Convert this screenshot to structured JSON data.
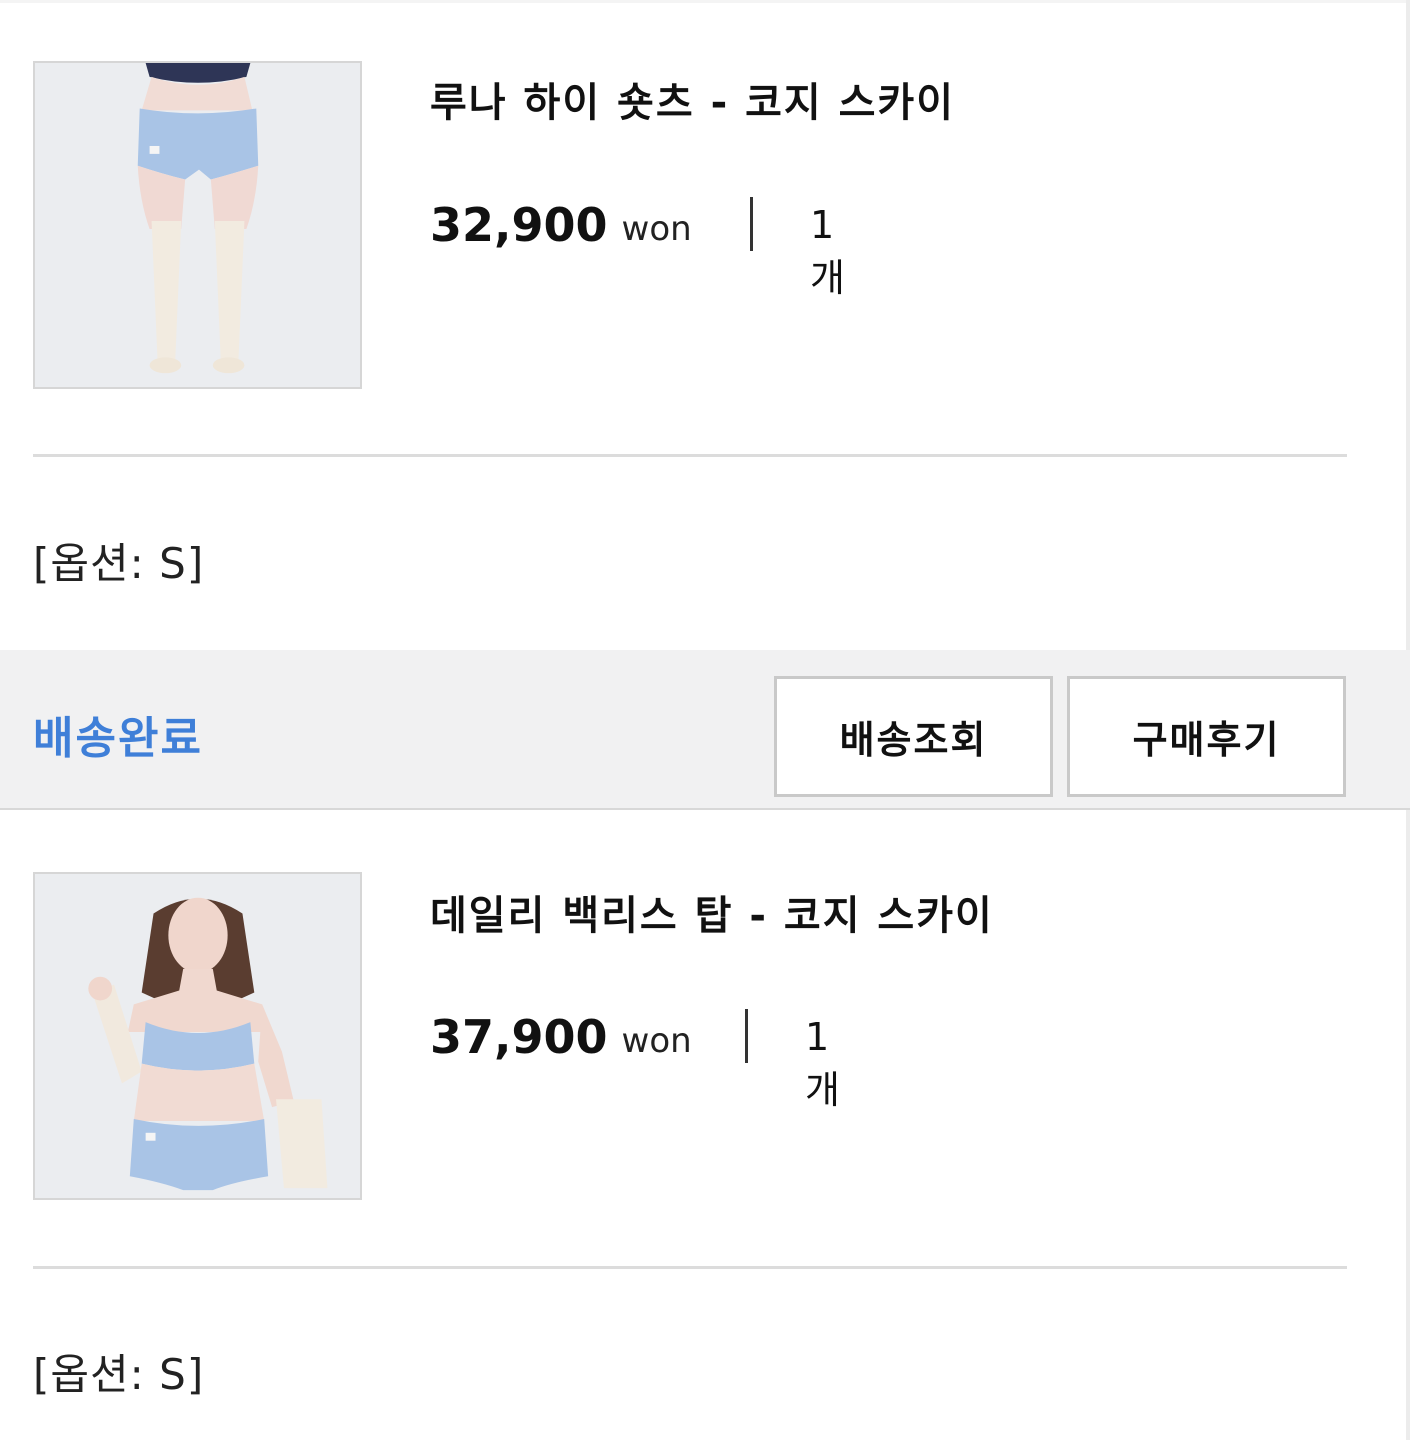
{
  "orders": [
    {
      "product_name": "루나 하이 숏츠 - 코지 스카이",
      "price": "32,900",
      "currency": "won",
      "quantity": "1개",
      "option": "[옵션: S]"
    },
    {
      "product_name": "데일리 백리스 탑 - 코지 스카이",
      "price": "37,900",
      "currency": "won",
      "quantity": "1개",
      "option": "[옵션: S]"
    }
  ],
  "status_bar": {
    "status": "배송완료",
    "status_color": "#3f7fd8",
    "track_button": "배송조회",
    "review_button": "구매후기"
  }
}
